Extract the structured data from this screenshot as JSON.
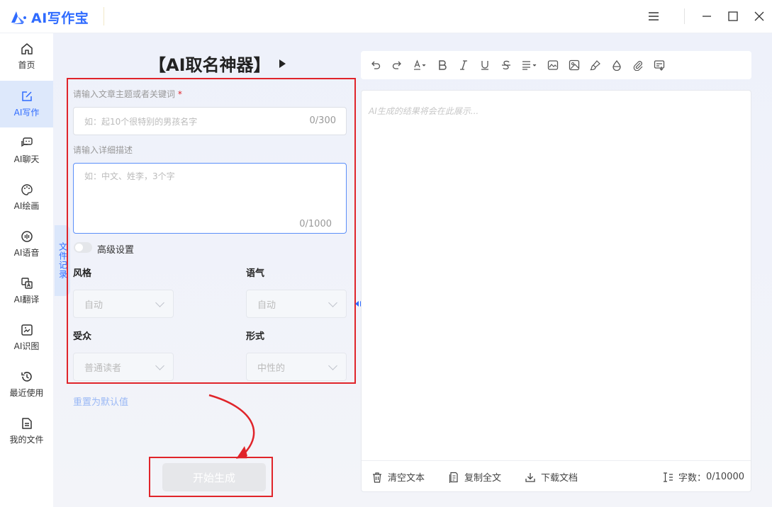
{
  "app": {
    "name": "AI写作宝",
    "brand_color": "#2f6bff"
  },
  "window": {
    "menu_icon": "hamburger-icon",
    "minimize_icon": "minimize-icon",
    "maximize_icon": "maximize-icon",
    "close_icon": "close-icon"
  },
  "sidebar": {
    "items": [
      {
        "label": "首页",
        "icon": "home-icon"
      },
      {
        "label": "AI写作",
        "icon": "edit-icon",
        "active": true
      },
      {
        "label": "AI聊天",
        "icon": "chat-icon"
      },
      {
        "label": "AI绘画",
        "icon": "palette-icon"
      },
      {
        "label": "AI语音",
        "icon": "audio-icon"
      },
      {
        "label": "AI翻译",
        "icon": "translate-icon"
      },
      {
        "label": "AI识图",
        "icon": "image-recognize-icon"
      },
      {
        "label": "最近使用",
        "icon": "history-icon"
      },
      {
        "label": "我的文件",
        "icon": "file-icon"
      }
    ]
  },
  "file_tab": {
    "label": "文件记录"
  },
  "form": {
    "title": "【AI取名神器】",
    "topic_label": "请输入文章主题或者关键词",
    "required_mark": "*",
    "topic_placeholder": "如：起10个很特别的男孩名字",
    "topic_counter": "0/300",
    "desc_label": "请输入详细描述",
    "desc_placeholder": "如：中文、姓李，3个字",
    "desc_counter": "0/1000",
    "advanced_label": "高级设置",
    "advanced_enabled": false,
    "style_label": "风格",
    "style_value": "自动",
    "tone_label": "语气",
    "tone_value": "自动",
    "audience_label": "受众",
    "audience_value": "普通读者",
    "form_label": "形式",
    "form_value": "中性的",
    "reset_label": "重置为默认值",
    "generate_label": "开始生成"
  },
  "editor": {
    "placeholder": "AI生成的结果将会在此展示...",
    "clear_label": "清空文本",
    "copy_label": "复制全文",
    "download_label": "下载文档",
    "word_count_label": "字数：",
    "word_count_value": "0/10000"
  },
  "annotation_color": "#e0242a"
}
